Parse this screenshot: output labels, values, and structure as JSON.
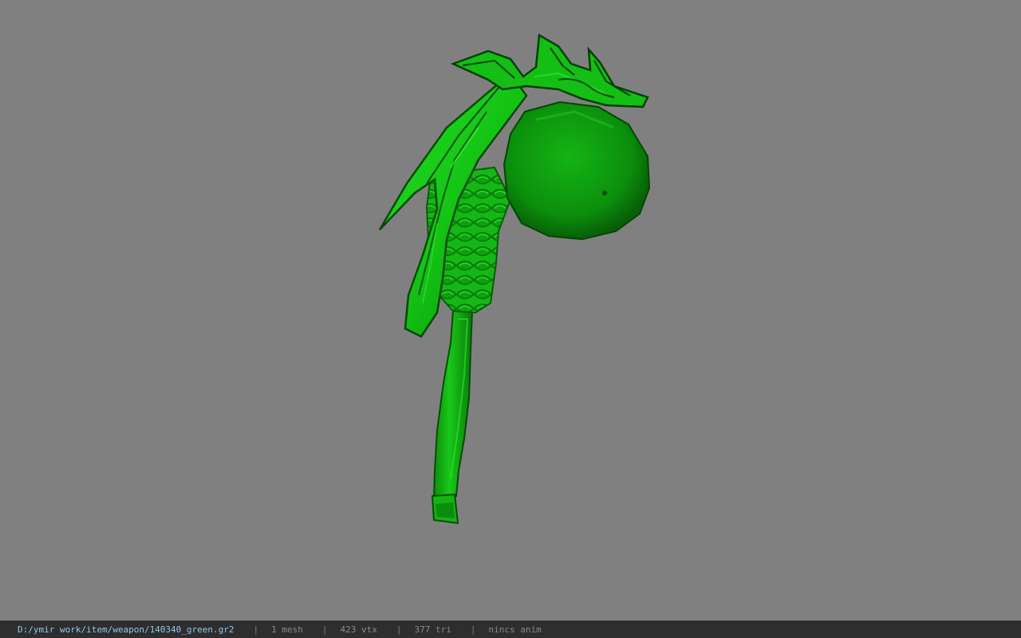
{
  "statusbar": {
    "path": "D:/ymir work/item/weapon/140340_green.gr2",
    "separator": "|",
    "mesh": "1 mesh",
    "vertices": "423 vtx",
    "triangles": "377 tri",
    "anim": "nincs anim"
  },
  "viewport": {
    "background_color": "#808080",
    "model_color": "#10c010",
    "model_shadow_color": "#0a5a0a",
    "model_highlight_color": "#26e626"
  }
}
